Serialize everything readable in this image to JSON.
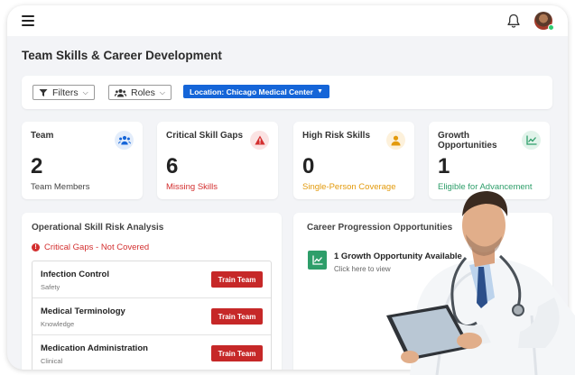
{
  "page": {
    "title": "Team Skills & Career Development"
  },
  "filters": {
    "filters_label": "Filters",
    "roles_label": "Roles",
    "location_label": "Location: Chicago Medical Center"
  },
  "stats": [
    {
      "label": "Team",
      "value": "2",
      "sub": "Team Members",
      "sub_color": "#444444",
      "icon": "team-icon",
      "icon_bg": "#e3edfb",
      "icon_color": "#1565d8"
    },
    {
      "label": "Critical Skill Gaps",
      "value": "6",
      "sub": "Missing Skills",
      "sub_color": "#d32f2f",
      "icon": "warning-icon",
      "icon_bg": "#fbe3e3",
      "icon_color": "#d32f2f"
    },
    {
      "label": "High Risk Skills",
      "value": "0",
      "sub": "Single-Person Coverage",
      "sub_color": "#e39a0c",
      "icon": "person-icon",
      "icon_bg": "#fdf1db",
      "icon_color": "#e39a0c"
    },
    {
      "label": "Growth Opportunities",
      "value": "1",
      "sub": "Eligible for Advancement",
      "sub_color": "#2e9e6a",
      "icon": "trend-chart-icon",
      "icon_bg": "#e1f3ea",
      "icon_color": "#2e9e6a"
    }
  ],
  "risk": {
    "title": "Operational Skill Risk Analysis",
    "critical_label": "Critical Gaps - Not Covered",
    "button_label": "Train Team",
    "skills": [
      {
        "name": "Infection Control",
        "category": "Safety"
      },
      {
        "name": "Medical Terminology",
        "category": "Knowledge"
      },
      {
        "name": "Medication Administration",
        "category": "Clinical"
      }
    ]
  },
  "career": {
    "title": "Career Progression Opportunities",
    "growth_title": "1 Growth Opportunity Available",
    "growth_sub": "Click here to view"
  },
  "colors": {
    "primary": "#1565d8",
    "danger": "#c62828",
    "success": "#2e9e6a",
    "warning": "#e39a0c"
  }
}
